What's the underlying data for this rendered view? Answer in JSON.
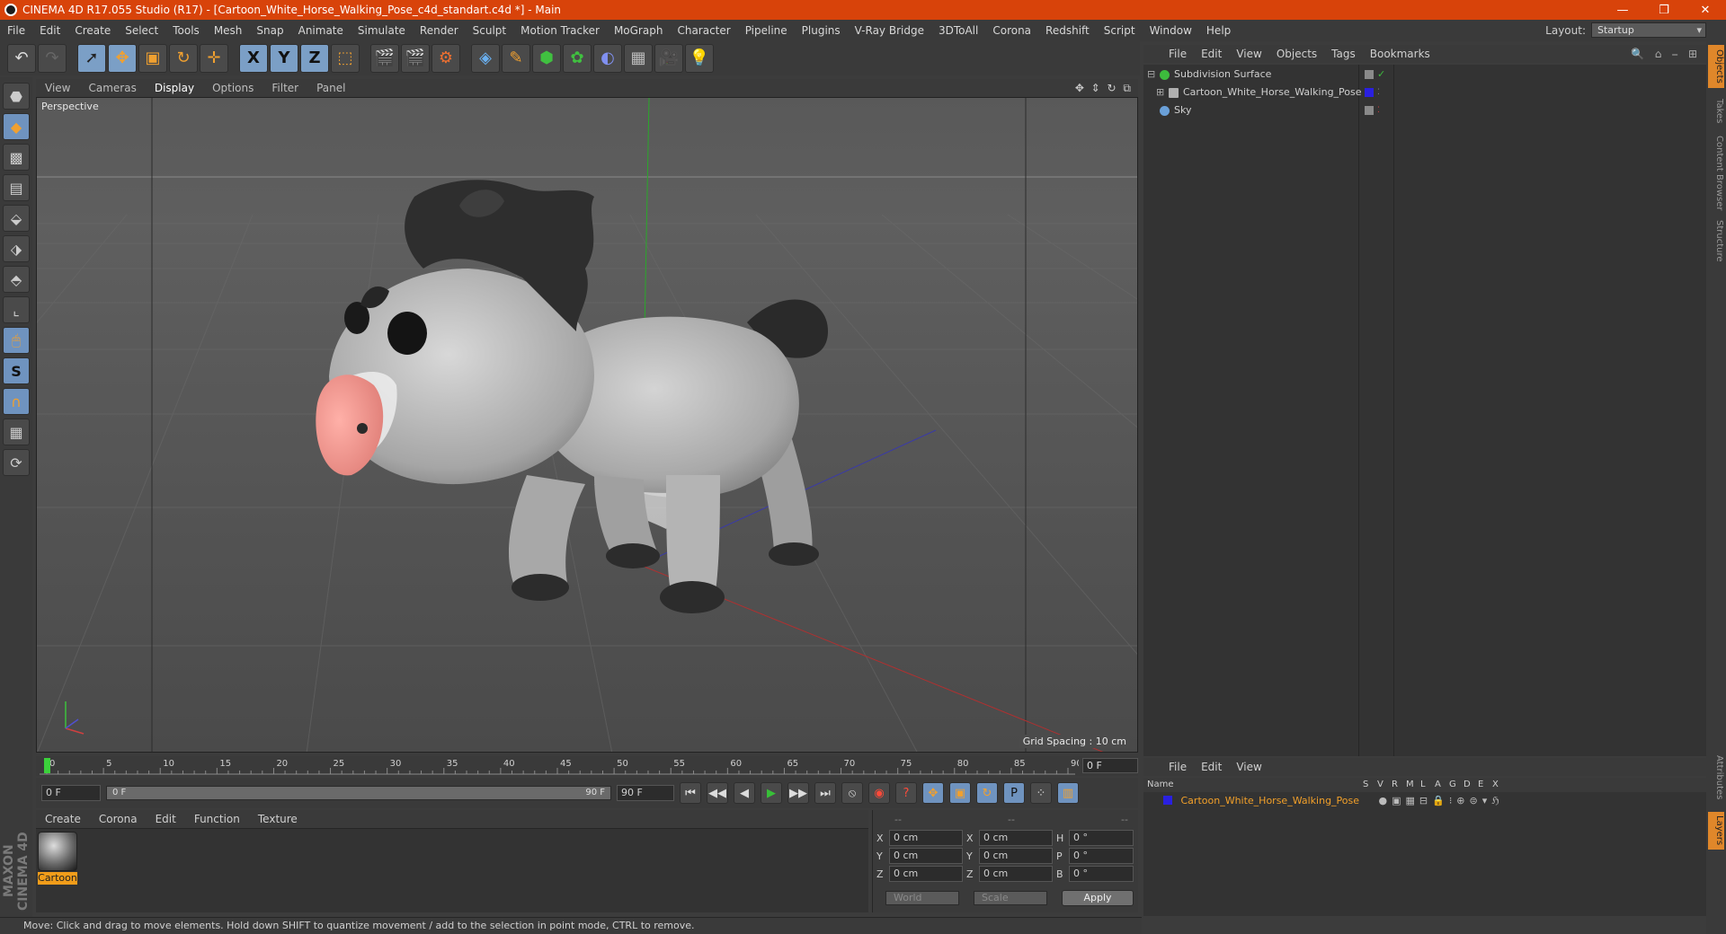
{
  "window": {
    "title": "CINEMA 4D R17.055 Studio (R17) - [Cartoon_White_Horse_Walking_Pose_c4d_standart.c4d *] - Main",
    "buttons": [
      "—",
      "❐",
      "✕"
    ]
  },
  "menubar": {
    "items": [
      "File",
      "Edit",
      "Create",
      "Select",
      "Tools",
      "Mesh",
      "Snap",
      "Animate",
      "Simulate",
      "Render",
      "Sculpt",
      "Motion Tracker",
      "MoGraph",
      "Character",
      "Pipeline",
      "Plugins",
      "V-Ray Bridge",
      "3DToAll",
      "Corona",
      "Redshift",
      "Script",
      "Window",
      "Help"
    ],
    "layout_label": "Layout:",
    "layout_value": "Startup"
  },
  "toolbar": {
    "icons": [
      "undo-icon",
      "redo-icon",
      "select-icon",
      "move-icon",
      "scale-icon",
      "rotate-icon",
      "live-select-icon",
      "x-axis-icon",
      "y-axis-icon",
      "z-axis-icon",
      "coordinate-system-icon",
      "render-view-icon",
      "render-picture-viewer-icon",
      "edit-render-settings-icon",
      "cube-icon",
      "pen-icon",
      "subdivision-icon",
      "cloner-icon",
      "deformer-icon",
      "floor-icon",
      "camera-icon",
      "light-icon"
    ],
    "axis_labels": [
      "X",
      "Y",
      "Z"
    ]
  },
  "left_tools": {
    "icons": [
      "make-editable-icon",
      "model-mode-icon",
      "texture-mode-icon",
      "workplane-icon",
      "points-mode-icon",
      "edges-mode-icon",
      "polygons-mode-icon",
      "axis-mode-icon",
      "tweak-mode-icon",
      "solo-icon",
      "magnet-icon",
      "snap-icon",
      "lock-workplane-icon"
    ],
    "solo_glyph": "S"
  },
  "brand": {
    "text": "MAXON CINEMA 4D"
  },
  "viewport": {
    "menu": [
      "View",
      "Cameras",
      "Display",
      "Options",
      "Filter",
      "Panel"
    ],
    "active_menu": "Display",
    "label": "Perspective",
    "grid_spacing": "Grid Spacing : 10 cm",
    "nav_icons": "✥ ⇕ ↻ ⧉"
  },
  "timeline": {
    "ticks": [
      "0",
      "5",
      "10",
      "15",
      "20",
      "25",
      "30",
      "35",
      "40",
      "45",
      "50",
      "55",
      "60",
      "65",
      "70",
      "75",
      "80",
      "85",
      "90"
    ],
    "current_frame": "0 F"
  },
  "anim": {
    "start": "0 F",
    "range_start": "0 F",
    "range_end": "90 F",
    "end": "90 F",
    "buttons": [
      "⏮",
      "◀◀",
      "◀",
      "▶",
      "▶▶",
      "⏭"
    ]
  },
  "materials": {
    "menu": [
      "Create",
      "Corona",
      "Edit",
      "Function",
      "Texture"
    ],
    "items": [
      {
        "name": "Cartoon"
      }
    ]
  },
  "coordinates": {
    "headers": [
      "--",
      "--",
      "--"
    ],
    "rows": [
      {
        "a": "X",
        "av": "0 cm",
        "b": "X",
        "bv": "0 cm",
        "c": "H",
        "cv": "0 °"
      },
      {
        "a": "Y",
        "av": "0 cm",
        "b": "Y",
        "bv": "0 cm",
        "c": "P",
        "cv": "0 °"
      },
      {
        "a": "Z",
        "av": "0 cm",
        "b": "Z",
        "bv": "0 cm",
        "c": "B",
        "cv": "0 °"
      }
    ],
    "mode": "World",
    "size_mode": "Scale",
    "apply": "Apply"
  },
  "status": {
    "text": "Move: Click and drag to move elements. Hold down SHIFT to quantize movement / add to the selection in point mode, CTRL to remove."
  },
  "object_manager": {
    "menu": [
      "File",
      "Edit",
      "View",
      "Objects",
      "Tags",
      "Bookmarks"
    ],
    "objects": [
      {
        "name": "Subdivision Surface",
        "color": "#3dbb3d"
      },
      {
        "name": "Cartoon_White_Horse_Walking_Pose",
        "color": "#b0b0b0"
      },
      {
        "name": "Sky",
        "color": "#6aa0d8"
      }
    ]
  },
  "layer_manager": {
    "menu": [
      "File",
      "Edit",
      "View"
    ],
    "columns": [
      "Name",
      "S",
      "V",
      "R",
      "M",
      "L",
      "A",
      "G",
      "D",
      "E",
      "X"
    ],
    "layers": [
      {
        "name": "Cartoon_White_Horse_Walking_Pose",
        "color": "#3a2ad6"
      }
    ]
  },
  "right_tabs": [
    "Objects",
    "Takes",
    "Content Browser",
    "Structure",
    "Attributes",
    "Layers"
  ],
  "colors": {
    "titlebar": "#d8430a",
    "accent": "#f29d1a",
    "highlight": "#6f93bf"
  }
}
